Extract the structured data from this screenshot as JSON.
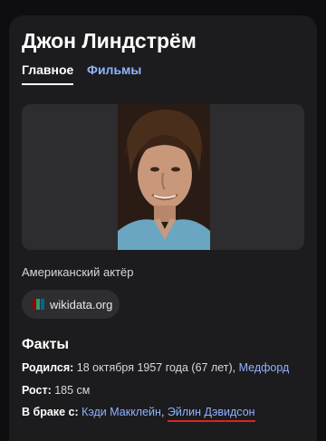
{
  "person": {
    "name": "Джон Линдстрём",
    "description": "Американский актёр",
    "photo_alt": "Джон Линдстрём"
  },
  "tabs": [
    {
      "label": "Главное",
      "active": true
    },
    {
      "label": "Фильмы",
      "active": false
    }
  ],
  "source_chip": {
    "label": "wikidata.org",
    "icon": "wikidata-icon",
    "icon_colors": [
      "#990000",
      "#339966",
      "#006699"
    ]
  },
  "facts": {
    "title": "Факты",
    "born": {
      "label": "Родился:",
      "value": "18 октября 1957 года (67 лет),",
      "place": "Медфорд"
    },
    "height": {
      "label": "Рост:",
      "value": "185 см"
    },
    "spouse": {
      "label": "В браке с:",
      "spouse1": "Кэди Макклейн",
      "separator": ",",
      "spouse2": "Эйлин Дэвидсон"
    }
  },
  "colors": {
    "background": "#0e0e10",
    "card": "#1c1c1e",
    "link": "#8fb3ff",
    "annotation_underline": "#d7261e"
  }
}
